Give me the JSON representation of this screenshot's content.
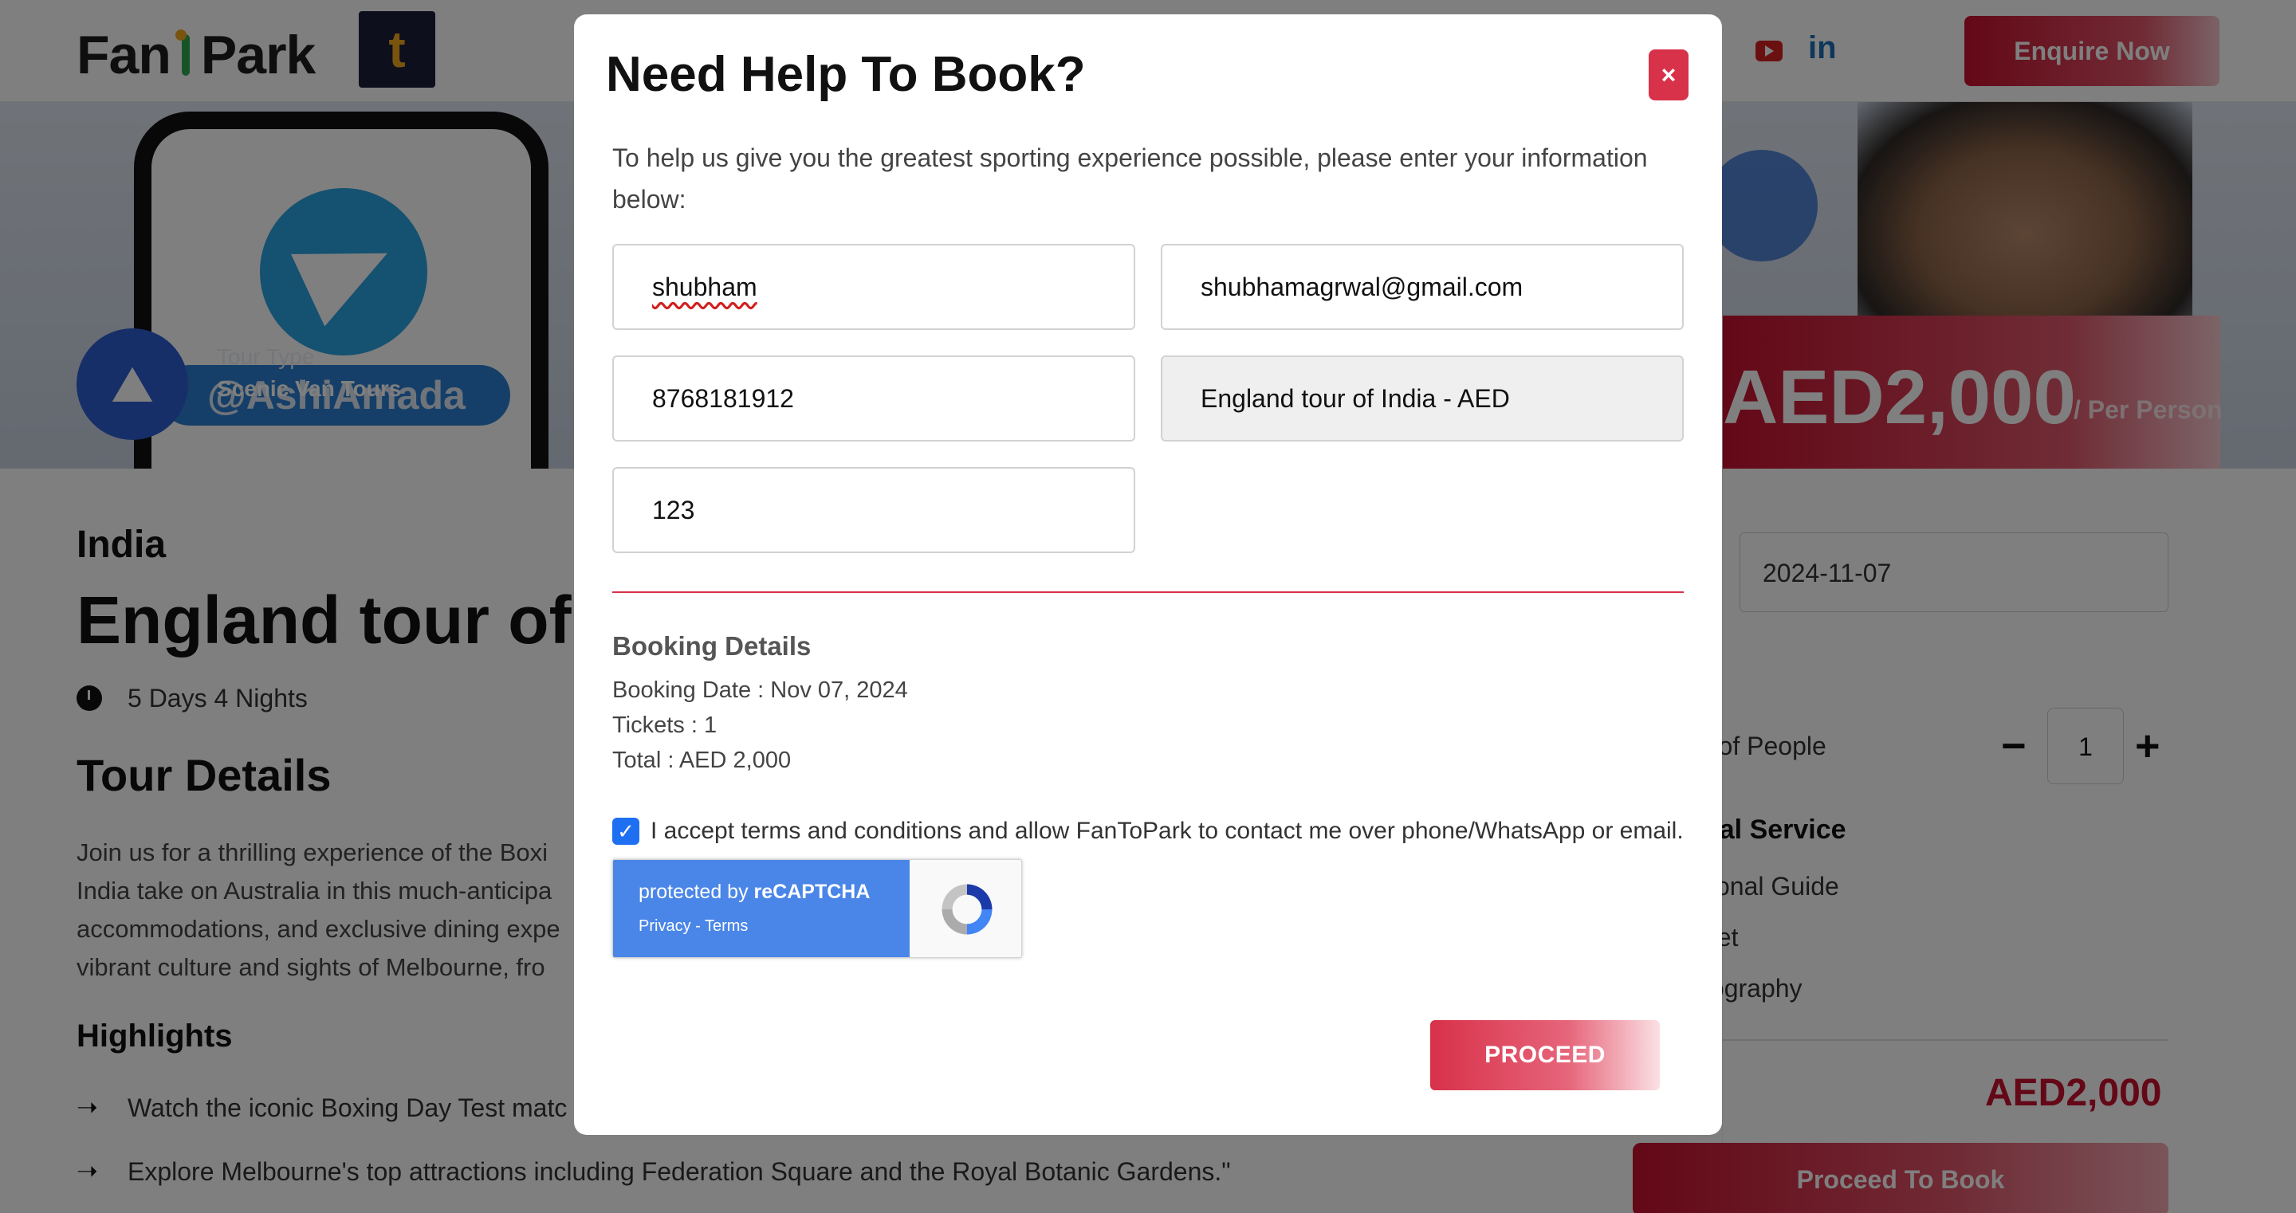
{
  "header": {
    "logo_text_left": "Fan",
    "logo_text_right": "Park",
    "app_badge_letter": "t",
    "enquire_label": "Enquire Now"
  },
  "hero": {
    "brand_text": "@AshiAmada",
    "tour_type_label": "Tour Type",
    "tour_type_value": "Scenic Van Tours"
  },
  "page": {
    "country": "India",
    "title": "England tour of In",
    "duration": "5 Days 4 Nights",
    "tour_details_heading": "Tour Details",
    "description_lines": [
      "Join us for a thrilling experience of the Boxi",
      "India take on Australia in this much-anticipa",
      "accommodations, and exclusive dining expe",
      "vibrant culture and sights of Melbourne, fro"
    ],
    "highlights_heading": "Highlights",
    "highlights": [
      "Watch the iconic Boxing Day Test matc",
      "Explore Melbourne's top attractions including Federation Square and the Royal Botanic Gardens.\""
    ]
  },
  "price_card": {
    "price": "AED2,000",
    "per_person": "/ Per Person",
    "date_value": "2024-11-07",
    "people_label": "r of People",
    "quantity": "1",
    "minus_symbol": "−",
    "plus_symbol": "+",
    "services_title": "nal Service",
    "services": [
      "tional Guide",
      "net",
      "tography"
    ],
    "total": "AED2,000",
    "proceed_label": "Proceed To Book"
  },
  "modal": {
    "title": "Need Help To Book?",
    "close_symbol": "×",
    "intro": "To help us give you the greatest sporting experience possible, please enter your information below:",
    "fields": {
      "name": "shubham",
      "email": "shubhamagrwal@gmail.com",
      "phone": "8768181912",
      "tour": "England tour of India - AED",
      "extra": "123"
    },
    "booking_details_title": "Booking Details",
    "booking_date": "Booking Date : Nov 07, 2024",
    "tickets": "Tickets : 1",
    "total": "Total : AED 2,000",
    "terms_checked": true,
    "terms_text": "I accept terms and conditions and allow FanToPark to contact me over phone/WhatsApp or email.",
    "recaptcha_prefix": "protected by ",
    "recaptcha_brand": "reCAPTCHA",
    "recaptcha_links": "Privacy - Terms",
    "proceed_label": "PROCEED"
  },
  "colors": {
    "accent": "#d8314a",
    "brand_red": "#c8102e",
    "checkbox_blue": "#1f6ff2",
    "recaptcha_blue": "#4a86e8"
  },
  "icons": [
    "clock-icon",
    "arrow-right-icon",
    "youtube-icon",
    "linkedin-icon",
    "close-icon",
    "checkbox-checked-icon",
    "recaptcha-logo-icon",
    "tour-van-icon",
    "telegram-icon"
  ]
}
